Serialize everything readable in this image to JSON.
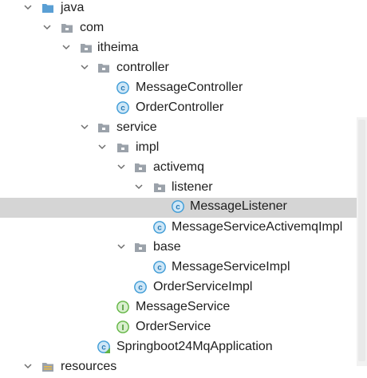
{
  "project_tree": {
    "nodes": [
      {
        "label": "java",
        "icon": "source-folder-icon",
        "expanded": true
      },
      {
        "label": "com",
        "icon": "package-icon",
        "expanded": true
      },
      {
        "label": "itheima",
        "icon": "package-icon",
        "expanded": true
      },
      {
        "label": "controller",
        "icon": "package-icon",
        "expanded": true
      },
      {
        "label": "MessageController",
        "icon": "class-icon"
      },
      {
        "label": "OrderController",
        "icon": "class-icon"
      },
      {
        "label": "service",
        "icon": "package-icon",
        "expanded": true
      },
      {
        "label": "impl",
        "icon": "package-icon",
        "expanded": true
      },
      {
        "label": "activemq",
        "icon": "package-icon",
        "expanded": true
      },
      {
        "label": "listener",
        "icon": "package-icon",
        "expanded": true
      },
      {
        "label": "MessageListener",
        "icon": "class-icon",
        "selected": true
      },
      {
        "label": "MessageServiceActivemqImpl",
        "icon": "class-icon"
      },
      {
        "label": "base",
        "icon": "package-icon",
        "expanded": true
      },
      {
        "label": "MessageServiceImpl",
        "icon": "class-icon"
      },
      {
        "label": "OrderServiceImpl",
        "icon": "class-icon"
      },
      {
        "label": "MessageService",
        "icon": "interface-icon"
      },
      {
        "label": "OrderService",
        "icon": "interface-icon"
      },
      {
        "label": "Springboot24MqApplication",
        "icon": "spring-boot-class-icon"
      },
      {
        "label": "resources",
        "icon": "resources-folder-icon",
        "expanded": true
      }
    ]
  },
  "colors": {
    "selection": "#d5d5d5",
    "source_folder": "#5a9fd4",
    "package_folder": "#9ba2aa",
    "class_icon": "#3d9bd6",
    "interface_icon": "#62b543",
    "chevron": "#6e6e6e"
  }
}
